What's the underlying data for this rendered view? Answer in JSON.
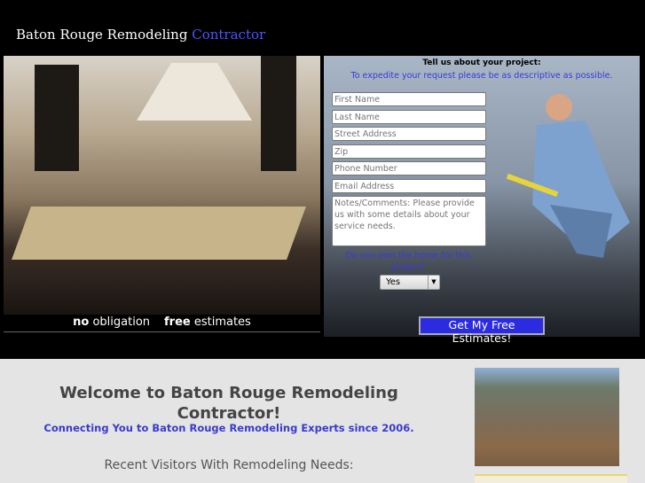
{
  "header": {
    "title_main": "Baton Rouge Remodeling",
    "title_accent": "Contractor"
  },
  "hero": {
    "caption_bold1": "no",
    "caption_rest1": " obligation",
    "caption_bold2": "free",
    "caption_rest2": " estimates"
  },
  "form": {
    "heading": "Tell us about your project:",
    "subheading": "To expedite your request please be as descriptive as possible.",
    "fields": [
      {
        "placeholder": "First Name"
      },
      {
        "placeholder": "Last Name"
      },
      {
        "placeholder": "Street Address"
      },
      {
        "placeholder": "Zip"
      },
      {
        "placeholder": "Phone Number"
      },
      {
        "placeholder": "Email Address"
      }
    ],
    "notes_placeholder": "Notes/Comments: Please provide us with some details about your service needs.",
    "own_question": "Do you own the home for this project?",
    "own_value": "Yes",
    "submit_label": "Get My Free Estimates!"
  },
  "content": {
    "welcome": "Welcome to Baton Rouge Remodeling Contractor!",
    "tagline": "Connecting You to Baton Rouge Remodeling Experts since 2006.",
    "recent": "Recent Visitors With Remodeling Needs:"
  },
  "colors": {
    "accent": "#3a3ad0",
    "button": "#2b2be0"
  }
}
